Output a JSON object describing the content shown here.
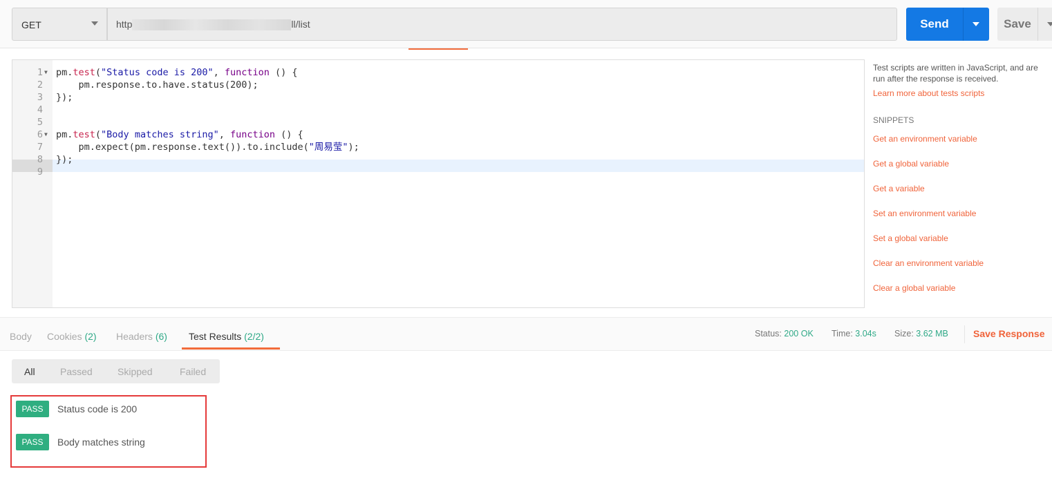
{
  "request": {
    "method": "GET",
    "url_prefix": "http",
    "url_suffix": "ll/list",
    "send_label": "Send",
    "save_label": "Save"
  },
  "editor": {
    "lines": [
      {
        "n": "1",
        "fold": true,
        "tokens": [
          [
            "pm.",
            ""
          ],
          [
            "test",
            "fn"
          ],
          [
            "(",
            ""
          ],
          [
            "\"Status code is 200\"",
            "str"
          ],
          [
            ", ",
            ""
          ],
          [
            "function",
            "kw"
          ],
          [
            " () {",
            ""
          ]
        ]
      },
      {
        "n": "2",
        "tokens": [
          [
            "    pm.response.to.have.status(200);",
            ""
          ]
        ]
      },
      {
        "n": "3",
        "tokens": [
          [
            "});",
            ""
          ]
        ]
      },
      {
        "n": "4",
        "tokens": []
      },
      {
        "n": "5",
        "tokens": []
      },
      {
        "n": "6",
        "fold": true,
        "tokens": [
          [
            "pm.",
            ""
          ],
          [
            "test",
            "fn"
          ],
          [
            "(",
            ""
          ],
          [
            "\"Body matches string\"",
            "str"
          ],
          [
            ", ",
            ""
          ],
          [
            "function",
            "kw"
          ],
          [
            " () {",
            ""
          ]
        ]
      },
      {
        "n": "7",
        "tokens": [
          [
            "    pm.expect(pm.response.text()).to.include(",
            ""
          ],
          [
            "\"周易莹\"",
            "str"
          ],
          [
            ");",
            ""
          ]
        ]
      },
      {
        "n": "8",
        "tokens": [
          [
            "});",
            ""
          ]
        ]
      },
      {
        "n": "9",
        "tokens": []
      }
    ]
  },
  "sidebar": {
    "description": "Test scripts are written in JavaScript, and are run after the response is received.",
    "learn_more": "Learn more about tests scripts",
    "snippets_heading": "SNIPPETS",
    "snippets": [
      "Get an environment variable",
      "Get a global variable",
      "Get a variable",
      "Set an environment variable",
      "Set a global variable",
      "Clear an environment variable",
      "Clear a global variable"
    ]
  },
  "response": {
    "tabs": [
      {
        "label": "Body",
        "count": ""
      },
      {
        "label": "Cookies",
        "count": "(2)"
      },
      {
        "label": "Headers",
        "count": "(6)"
      },
      {
        "label": "Test Results",
        "count": "(2/2)",
        "active": true
      }
    ],
    "status_label": "Status:",
    "status": "200 OK",
    "time_label": "Time:",
    "time": "3.04s",
    "size_label": "Size:",
    "size": "3.62 MB",
    "save_response": "Save Response",
    "filters": [
      "All",
      "Passed",
      "Skipped",
      "Failed"
    ],
    "results": [
      {
        "badge": "PASS",
        "name": "Status code is 200"
      },
      {
        "badge": "PASS",
        "name": "Body matches string"
      }
    ]
  },
  "colors": {
    "accent": "#f26b3a",
    "send": "#1479e4",
    "pass": "#2fae80",
    "highlight_box": "#e53a3a"
  }
}
